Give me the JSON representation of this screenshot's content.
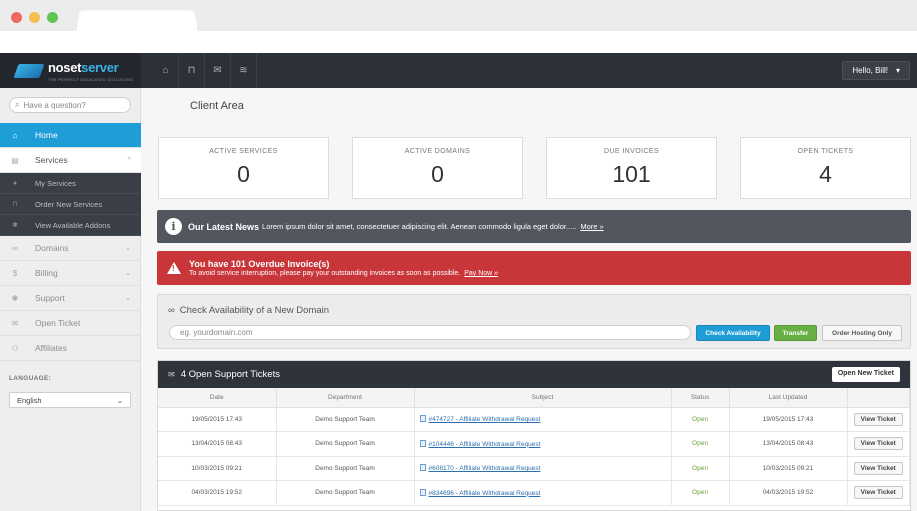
{
  "header": {
    "logo_main": "noset",
    "logo_bold": "server",
    "logo_sub": "THE PERFECT DEDICATED SOLUTIONS",
    "icons": [
      "home-icon",
      "basket-icon",
      "envelope-icon",
      "wifi-icon"
    ],
    "user_greeting": "Hello, Bill!",
    "user_caret": "▾"
  },
  "sidebar": {
    "search_placeholder": "Have a question?",
    "items": [
      {
        "label": "Home",
        "icon": "home-icon",
        "glyph": "⌂"
      },
      {
        "label": "Services",
        "icon": "box-icon",
        "glyph": "▤",
        "chev": "^"
      },
      {
        "label": "My Services",
        "icon": "user-icon",
        "glyph": "●"
      },
      {
        "label": "Order New Services",
        "icon": "basket-icon",
        "glyph": "⊓"
      },
      {
        "label": "View Available Addons",
        "icon": "gear-icon",
        "glyph": "✱"
      },
      {
        "label": "Domains",
        "icon": "binoculars-icon",
        "glyph": "∞",
        "chev": "⌄"
      },
      {
        "label": "Billing",
        "icon": "dollar-icon",
        "glyph": "$",
        "chev": "⌄"
      },
      {
        "label": "Support",
        "icon": "gear-icon",
        "glyph": "✱",
        "chev": "⌄"
      },
      {
        "label": "Open Ticket",
        "icon": "envelope-icon",
        "glyph": "✉"
      },
      {
        "label": "Affiliates",
        "icon": "group-icon",
        "glyph": "⚇"
      }
    ],
    "language_label": "LANGUAGE:",
    "language_value": "English",
    "language_caret": "⌄"
  },
  "main": {
    "title": "Client Area",
    "stats": [
      {
        "label": "ACTIVE SERVICES",
        "value": "0"
      },
      {
        "label": "ACTIVE DOMAINS",
        "value": "0"
      },
      {
        "label": "DUE INVOICES",
        "value": "101"
      },
      {
        "label": "OPEN TICKETS",
        "value": "4"
      }
    ],
    "news": {
      "icon_glyph": "i",
      "title": "Our Latest News",
      "text": "Lorem ipsum dolor sit amet, consectetuer adipiscing elit. Aenean commodo ligula eget dolor.....",
      "more": "More »"
    },
    "alert": {
      "icon_glyph": "!",
      "title": "You have 101 Overdue Invoice(s)",
      "text": "To avoid service interruption, please pay your outstanding invoices as soon as possible.",
      "link": "Pay Now »"
    },
    "domain": {
      "title": "Check Availability of a New Domain",
      "placeholder": "eg. yourdomain.com",
      "check_label": "Check Availability",
      "transfer_label": "Transfer",
      "order_label": "Order Hosting Only"
    },
    "tickets": {
      "header": "4  Open Support Tickets",
      "open_new": "Open New Ticket",
      "columns": [
        "Date",
        "Department",
        "Subject",
        "Status",
        "Last Updated",
        ""
      ],
      "rows": [
        {
          "date": "19/05/2015 17:43",
          "dept": "Demo Support Team",
          "subject": "#474727 - Affiliate Withdrawal Request",
          "status": "Open",
          "updated": "19/05/2015 17:43",
          "action": "View Ticket"
        },
        {
          "date": "13/04/2015 08:43",
          "dept": "Demo Support Team",
          "subject": "#104446 - Affiliate Withdrawal Request",
          "status": "Open",
          "updated": "13/04/2015 08:43",
          "action": "View Ticket"
        },
        {
          "date": "10/03/2015 09:21",
          "dept": "Demo Support Team",
          "subject": "#608170 - Affiliate Withdrawal Request",
          "status": "Open",
          "updated": "10/03/2015 09:21",
          "action": "View Ticket"
        },
        {
          "date": "04/03/2015 19:52",
          "dept": "Demo Support Team",
          "subject": "#834696 - Affiliate Withdrawal Request",
          "status": "Open",
          "updated": "04/03/2015 19:52",
          "action": "View Ticket"
        }
      ]
    }
  }
}
